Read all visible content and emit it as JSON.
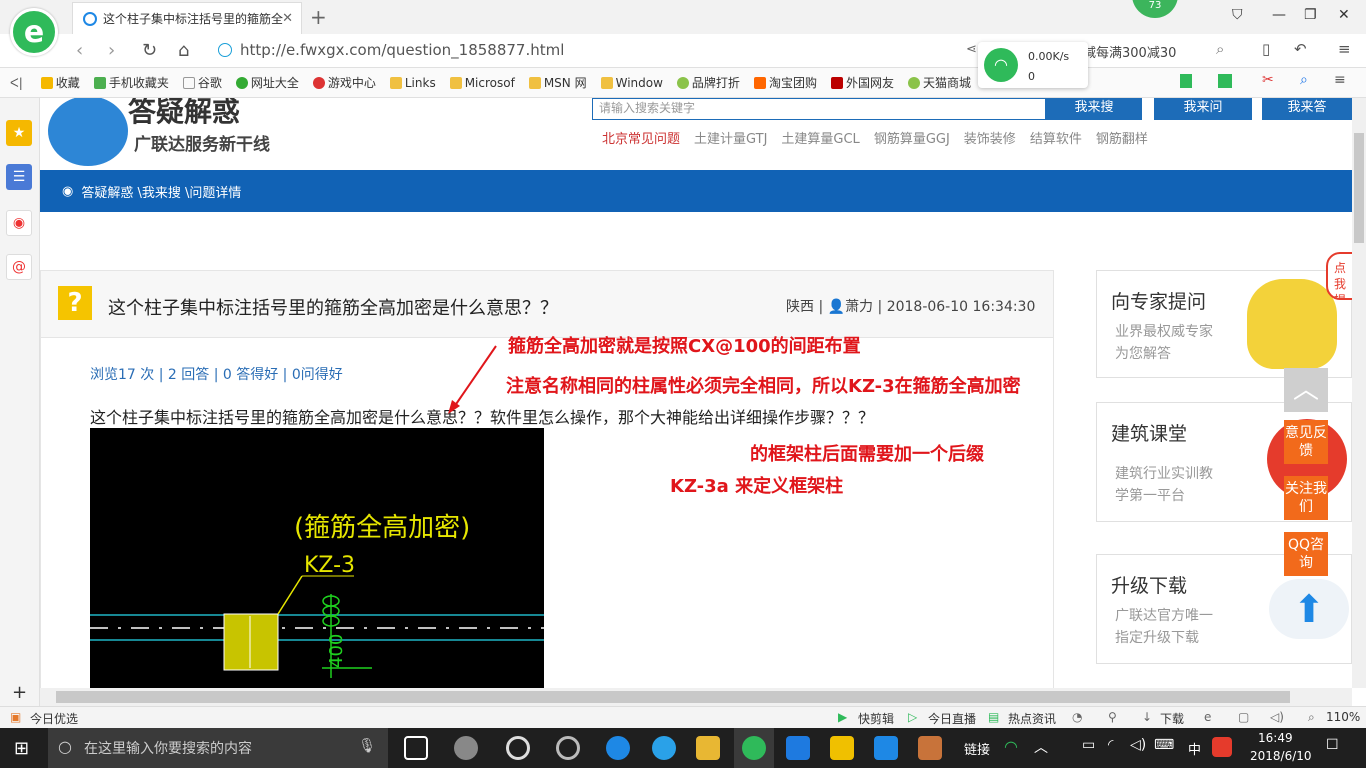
{
  "browser": {
    "tab_title": "这个柱子集中标注括号里的箍筋全",
    "badge": "73",
    "url": "http://e.fwxgx.com/question_1858877.html",
    "promo": "满减每满300减30",
    "net_speed": "0.00K/s",
    "net_conn": "0"
  },
  "bookmarks": [
    "收藏",
    "手机收藏夹",
    "谷歌",
    "网址大全",
    "游戏中心",
    "Links",
    "Microsof",
    "MSN 网",
    "Window",
    "品牌打折",
    "淘宝团购",
    "外国网友",
    "天猫商城"
  ],
  "site": {
    "title": "答疑解惑",
    "subtitle": "广联达服务新干线",
    "search_placeholder": "请输入搜索关键字",
    "btn_search": "我来搜",
    "btn_ask": "我来问",
    "btn_answer": "我来答",
    "quicklinks": [
      "北京常见问题",
      "土建计量GTJ",
      "土建算量GCL",
      "钢筋算量GGJ",
      "装饰装修",
      "结算软件",
      "钢筋翻样"
    ],
    "breadcrumb": "答疑解惑 \\我来搜 \\问题详情"
  },
  "question": {
    "title": "这个柱子集中标注括号里的箍筋全高加密是什么意思？？",
    "region": "陕西",
    "user": "萧力",
    "datetime": "2018-06-10 16:34:30",
    "stats": "浏览17 次 | 2 回答 | 0 答得好 | 0问得好",
    "body": "这个柱子集中标注括号里的箍筋全高加密是什么意思？？软件里怎么操作，那个大神能给出详细操作步骤？？？",
    "cad_text1": "(箍筋全高加密)",
    "cad_text2": "KZ-3",
    "cad_text3": "400"
  },
  "annotations": [
    "箍筋全高加密就是按照CX@100的间距布置",
    "注意名称相同的柱属性必须完全相同，所以KZ-3在箍筋全高加密",
    "的框架柱后面需要加一个后缀",
    "KZ-3a 来定义框架柱"
  ],
  "cards": [
    {
      "title": "向专家提问",
      "sub1": "业界最权威专家",
      "sub2": "为您解答"
    },
    {
      "title": "建筑课堂",
      "sub1": "建筑行业实训教",
      "sub2": "学第一平台"
    },
    {
      "title": "升级下载",
      "sub1": "广联达官方唯一",
      "sub2": "指定升级下载"
    }
  ],
  "side_buttons": [
    "意见反馈",
    "关注我们",
    "QQ咨询"
  ],
  "click_bubble": "点我提问",
  "status": {
    "left": "今日优选",
    "items": [
      "快剪辑",
      "今日直播",
      "热点资讯",
      "下载"
    ],
    "zoom": "110%"
  },
  "taskbar": {
    "search_placeholder": "在这里输入你要搜索的内容",
    "link_label": "链接",
    "ime": "中",
    "time": "16:49",
    "date": "2018/6/10"
  }
}
